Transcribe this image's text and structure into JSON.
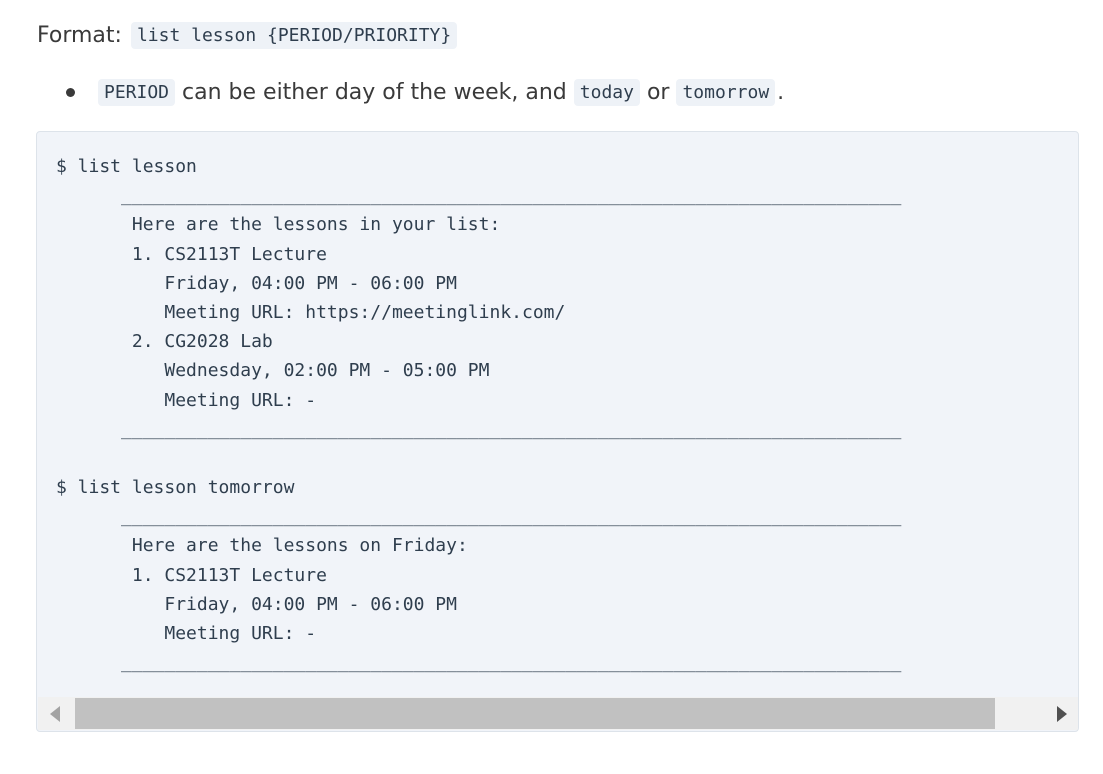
{
  "format": {
    "label": "Format:",
    "code": "list lesson {PERIOD/PRIORITY}"
  },
  "bullet": {
    "code1": "PERIOD",
    "text1": "can be either day of the week, and",
    "code2": "today",
    "text2": "or",
    "code3": "tomorrow",
    "text3": "."
  },
  "code_block": {
    "lines": [
      "$ list lesson",
      "      ________________________________________________________________________",
      "       Here are the lessons in your list:",
      "       1. CS2113T Lecture",
      "          Friday, 04:00 PM - 06:00 PM",
      "          Meeting URL: https://meetinglink.com/",
      "       2. CG2028 Lab",
      "          Wednesday, 02:00 PM - 05:00 PM",
      "          Meeting URL: -",
      "      ________________________________________________________________________",
      "",
      "$ list lesson tomorrow",
      "      ________________________________________________________________________",
      "       Here are the lessons on Friday:",
      "       1. CS2113T Lecture",
      "          Friday, 04:00 PM - 06:00 PM",
      "          Meeting URL: -",
      "      ________________________________________________________________________"
    ]
  }
}
